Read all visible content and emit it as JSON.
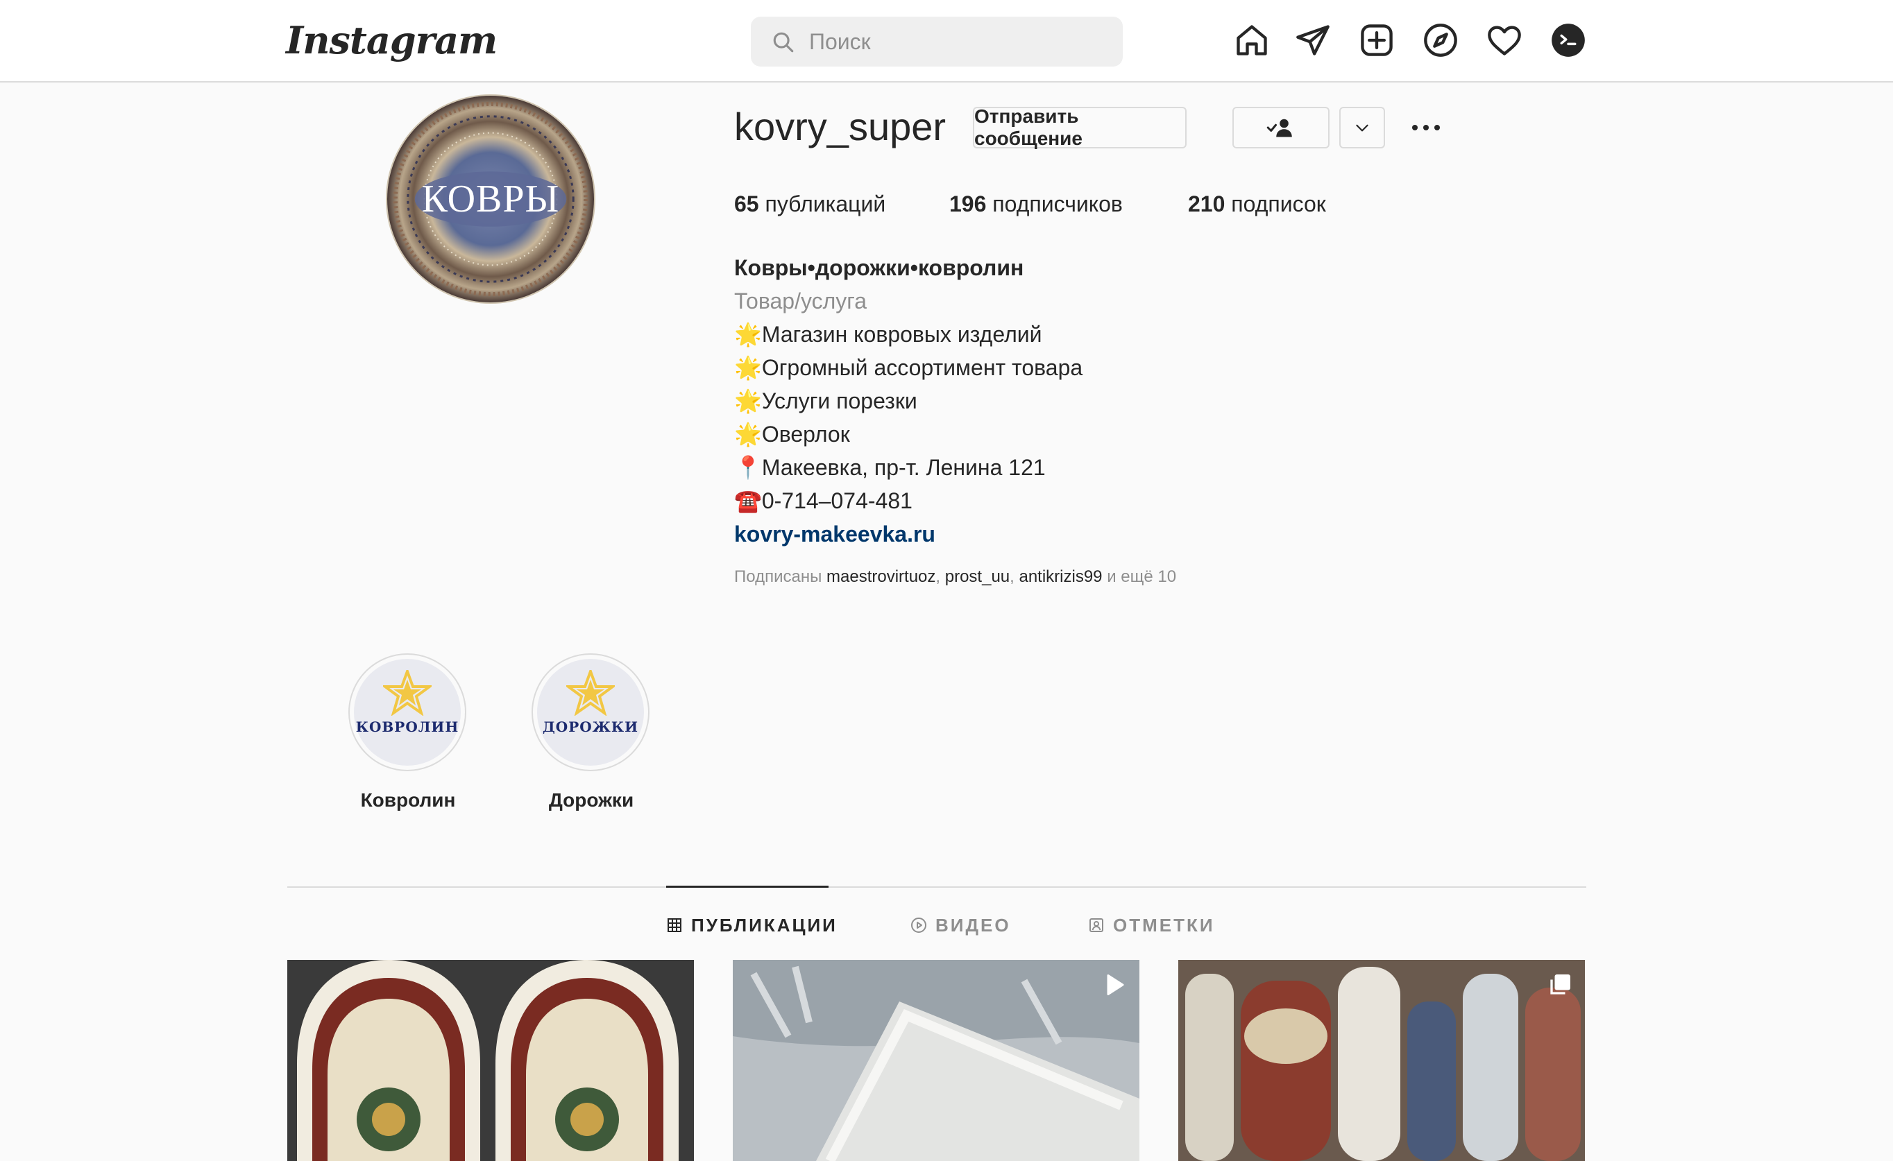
{
  "topbar": {
    "logo": "Instagram",
    "search_placeholder": "Поиск",
    "icons": [
      "home-icon",
      "direct-icon",
      "new-post-icon",
      "explore-icon",
      "activity-icon",
      "profile-avatar-icon"
    ]
  },
  "profile": {
    "avatar_text": "КОВРЫ",
    "username": "kovry_super",
    "message_button": "Отправить сообщение",
    "following_icon": "person-check-icon",
    "suggest_icon": "chevron-down-icon",
    "more_icon": "more-dots-icon",
    "stats": {
      "posts_count": "65",
      "posts_label": "публикаций",
      "followers_count": "196",
      "followers_label": "подписчиков",
      "following_count": "210",
      "following_label": "подписок"
    },
    "bio": {
      "name": "Ковры•дорожки•ковролин",
      "category": "Товар/услуга",
      "lines": [
        "🌟Магазин ковровых изделий",
        "🌟Огромный ассортимент товара",
        "🌟Услуги порезки",
        "🌟Оверлок",
        "📍Макеевка, пр-т. Ленина 121",
        "☎️0-714–074-481"
      ],
      "link": "kovry-makeevka.ru"
    },
    "followed_by": {
      "prefix": "Подписаны",
      "accounts": [
        "maestrovirtuoz",
        "prost_uu",
        "antikrizis99"
      ],
      "suffix": "и ещё 10"
    }
  },
  "highlights": [
    {
      "cover_text": "КОВРОЛИН",
      "label": "Ковролин"
    },
    {
      "cover_text": "ДОРОЖКИ",
      "label": "Дорожки"
    }
  ],
  "tabs": [
    {
      "label": "ПУБЛИКАЦИИ",
      "icon": "grid-icon",
      "active": true
    },
    {
      "label": "ВИДЕО",
      "icon": "video-icon",
      "active": false
    },
    {
      "label": "ОТМЕТКИ",
      "icon": "tagged-icon",
      "active": false
    }
  ],
  "posts": [
    {
      "type": "photo"
    },
    {
      "type": "video",
      "icon": "video-play-icon"
    },
    {
      "type": "carousel",
      "icon": "carousel-icon"
    }
  ],
  "colors": {
    "background": "#fafafa",
    "border": "#dbdbdb",
    "text": "#262626",
    "secondary_text": "#8e8e8e",
    "link": "#00376b",
    "star": "#f2c744"
  }
}
